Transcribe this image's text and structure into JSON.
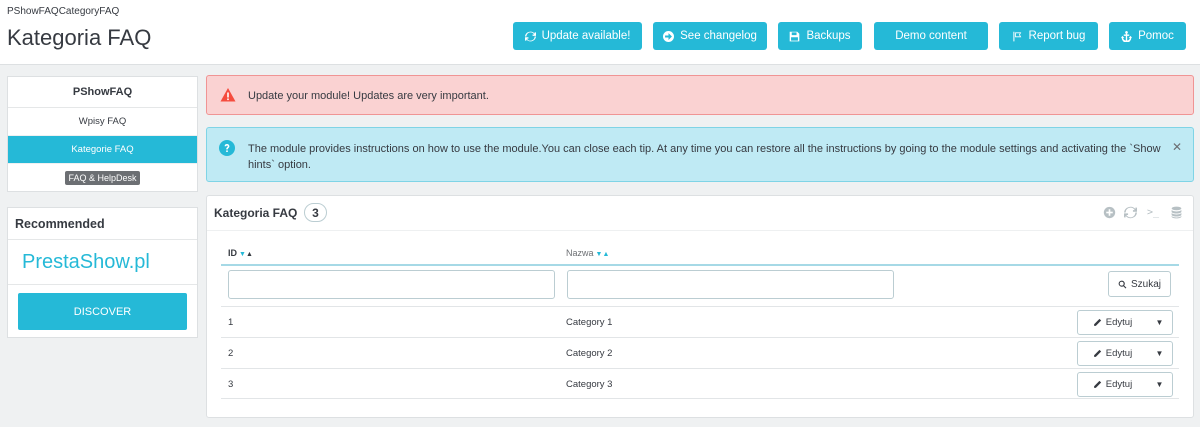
{
  "header": {
    "breadcrumb": "PShowFAQCategoryFAQ",
    "title": "Kategoria FAQ",
    "buttons": {
      "update": "Update available!",
      "changelog": "See changelog",
      "backups": "Backups",
      "demo": "Demo content",
      "report": "Report bug",
      "help": "Pomoc"
    }
  },
  "sidebar": {
    "menu_title": "PShowFAQ",
    "items": [
      {
        "label": "Wpisy FAQ"
      },
      {
        "label": "Kategorie FAQ"
      },
      {
        "label": "FAQ & HelpDesk"
      }
    ],
    "recommended": {
      "title": "Recommended",
      "brand": "PrestaShow.pl",
      "button": "DISCOVER"
    }
  },
  "alerts": {
    "danger": "Update your module! Updates are very important.",
    "info": "The module provides instructions on how to use the module.You can close each tip. At any time you can restore all the instructions by going to the module settings and activating the `Show hints` option."
  },
  "panel": {
    "title": "Kategoria FAQ",
    "count": "3",
    "columns": {
      "id": "ID",
      "name": "Nazwa"
    },
    "search_label": "Szukaj",
    "edit_label": "Edytuj",
    "rows": [
      {
        "id": "1",
        "name": "Category 1"
      },
      {
        "id": "2",
        "name": "Category 2"
      },
      {
        "id": "3",
        "name": "Category 3"
      }
    ]
  },
  "colors": {
    "accent": "#25b9d7",
    "danger_bg": "#fad2d2",
    "info_bg": "#bfeaf4"
  }
}
